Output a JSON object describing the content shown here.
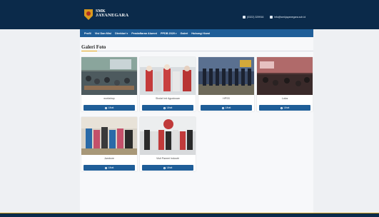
{
  "header": {
    "brand_line1": "SMK",
    "brand_line2": "JAYANEGARA",
    "phone": "(0322) 329916",
    "email": "info@smkjayanegara.sch.id"
  },
  "nav": {
    "items": [
      {
        "label": "Profil",
        "dropdown": false
      },
      {
        "label": "Visi Dan Misi",
        "dropdown": false
      },
      {
        "label": "Direktori",
        "dropdown": true
      },
      {
        "label": "Pendaftaran Alumni",
        "dropdown": false
      },
      {
        "label": "PPDB 2020",
        "dropdown": true
      },
      {
        "label": "Galeri",
        "dropdown": false
      },
      {
        "label": "Hubungi Kami",
        "dropdown": false
      }
    ]
  },
  "page": {
    "title": "Galeri Foto"
  },
  "gallery": {
    "button_label": "Lihat",
    "items": [
      {
        "caption": "workshop"
      },
      {
        "caption": "Sholat Ied Agustusan"
      },
      {
        "caption": "HPSS"
      },
      {
        "caption": "Lulus"
      },
      {
        "caption": "Jambore"
      },
      {
        "caption": "Visit Pameri Industri"
      }
    ]
  },
  "colors": {
    "header_bg": "#0b2a4a",
    "nav_bg": "#1f5e98",
    "accent": "#e4a61a",
    "button_bg": "#1f5e98"
  },
  "icons": [
    "school-logo-icon",
    "phone-icon",
    "mail-icon",
    "search-icon"
  ]
}
